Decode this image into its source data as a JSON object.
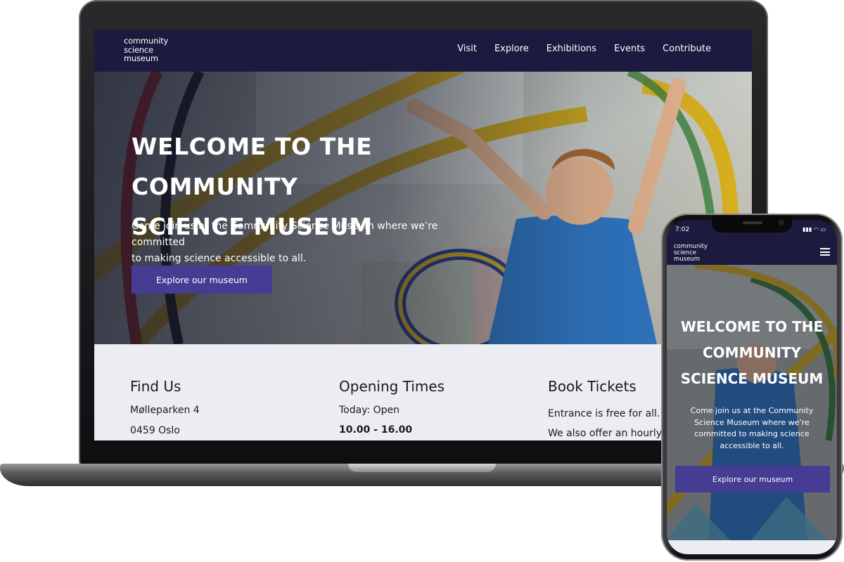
{
  "brand": {
    "logo_lines": [
      "community",
      "science",
      "museum"
    ]
  },
  "nav": {
    "items": [
      "Visit",
      "Explore",
      "Exhibitions",
      "Events",
      "Contribute"
    ]
  },
  "hero": {
    "title_line1": "WELCOME TO THE COMMUNITY",
    "title_line2": "SCIENCE MUSEUM",
    "text_line1": "Come join us at the Community Science Museum where we’re committed",
    "text_line2": "to making science accessible to all.",
    "button_label": "Explore our museum"
  },
  "info": {
    "find_us": {
      "heading": "Find Us",
      "address_line1": "Mølleparken 4",
      "address_line2": "0459 Oslo"
    },
    "opening_times": {
      "heading": "Opening Times",
      "today": "Today: Open",
      "hours": "10.00 - 16.00"
    },
    "book_tickets": {
      "heading": "Book Tickets",
      "line1": "Entrance is free for all.",
      "line2": "We also offer an hourly g"
    }
  },
  "mobile": {
    "status_time": "7:02",
    "title_line1": "WELCOME TO THE",
    "title_line2": "COMMUNITY",
    "title_line3": "SCIENCE MUSEUM",
    "text_line1": "Come join us at the Community",
    "text_line2": "Science Museum where we’re",
    "text_line3": "committed to making science",
    "text_line4": "accessible to all.",
    "button_label": "Explore our museum"
  },
  "colors": {
    "nav_bg": "#1c1a3e",
    "accent_button": "#463c93",
    "section_bg": "#ecedf2"
  },
  "icons": [
    "hamburger-menu-icon",
    "signal-icon",
    "wifi-icon",
    "battery-icon"
  ]
}
